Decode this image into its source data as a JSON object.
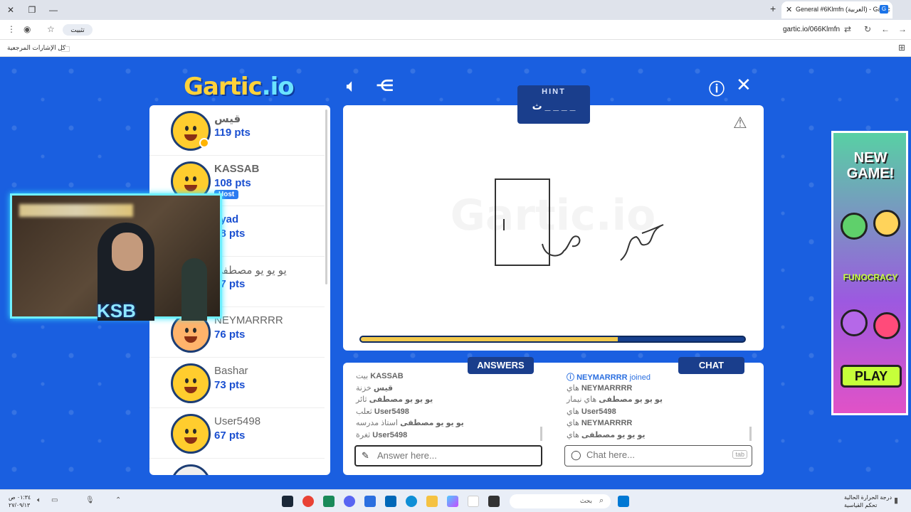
{
  "browser": {
    "tab_title": "General #6Klmfn (العربية) - Gartic",
    "tab_favicon": "G",
    "url": "gartic.io/066Klmfn",
    "install_label": "تثبيت",
    "bookmarks_all": "كل الإشارات المرجعية"
  },
  "game": {
    "logo_main": "Gartic",
    "logo_suffix": ".io",
    "hint_title": "HINT",
    "hint_word": "ث _ _ _ _",
    "timer_fraction": 0.67,
    "answers_label": "ANSWERS",
    "chat_label": "CHAT",
    "answer_placeholder": "Answer here...",
    "chat_placeholder": "Chat here...",
    "tab_key": "tab"
  },
  "players": [
    {
      "name": "قيس",
      "pts": "119 pts"
    },
    {
      "name": "KASSAB",
      "pts": "108 pts",
      "host": "Host"
    },
    {
      "name": "ayad",
      "pts": "98 pts"
    },
    {
      "name": "يو يو يو مصطفى",
      "pts": "87 pts"
    },
    {
      "name": "NEYMARRRR",
      "pts": "76 pts"
    },
    {
      "name": "Bashar",
      "pts": "73 pts"
    },
    {
      "name": "User5498",
      "pts": "67 pts"
    }
  ],
  "answers": [
    {
      "user": "KASSAB",
      "text": "بيت"
    },
    {
      "user": "قيس",
      "text": "خزنة"
    },
    {
      "user": "يو يو يو مصطفى",
      "text": "ثائر"
    },
    {
      "user": "User5498",
      "text": "ثعلب"
    },
    {
      "user": "يو يو يو مصطفى",
      "text": "استاذ مدرسه"
    },
    {
      "user": "User5498",
      "text": "ثغرة"
    }
  ],
  "chat": [
    {
      "user": "NEYMARRRR",
      "text": "joined",
      "system": true
    },
    {
      "user": "NEYMARRRR",
      "text": "هاي"
    },
    {
      "user": "يو يو يو مصطفى",
      "text": "هاي نيمار"
    },
    {
      "user": "User5498",
      "text": "هاي"
    },
    {
      "user": "NEYMARRRR",
      "text": "هاي"
    },
    {
      "user": "يو يو يو مصطفى",
      "text": "هاي"
    }
  ],
  "ad": {
    "headline": "NEW GAME!",
    "brand": "FUNOCRACY",
    "cta": "PLAY"
  },
  "cam": {
    "logo": "KSB"
  },
  "taskbar": {
    "search": "بحث",
    "weather_line1": "درجة الحرارة الحالية",
    "weather_line2": "تحكم القياسية",
    "time": "٠١:٣٤ ص",
    "date": "٢٧/٠٩/١٣"
  },
  "colors": {
    "game_bg": "#1a5fe0",
    "panel_dark": "#1a3e8c",
    "avatar_yellow": "#ffcd2e",
    "timer_fill": "#f2c94c"
  }
}
